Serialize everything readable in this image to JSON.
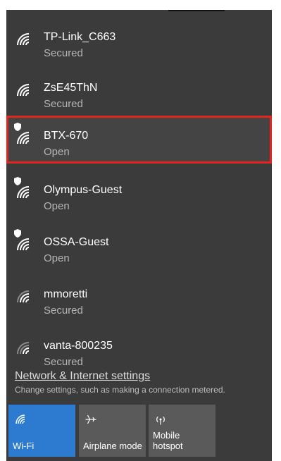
{
  "networks": [
    {
      "name": "TP-Link_C663",
      "status": "Secured",
      "shield": false
    },
    {
      "name": "ZsE45ThN",
      "status": "Secured",
      "shield": false
    },
    {
      "name": "BTX-670",
      "status": "Open",
      "shield": true,
      "selected": true
    },
    {
      "name": "Olympus-Guest",
      "status": "Open",
      "shield": true
    },
    {
      "name": "OSSA-Guest",
      "status": "Open",
      "shield": true
    },
    {
      "name": "mmoretti",
      "status": "Secured",
      "shield": false
    },
    {
      "name": "vanta-800235",
      "status": "Secured",
      "shield": false
    }
  ],
  "settings": {
    "link": "Network & Internet settings",
    "description": "Change settings, such as making a connection metered."
  },
  "tiles": {
    "wifi": {
      "label": "Wi-Fi",
      "icon": "wifi-icon",
      "active": true
    },
    "airplane": {
      "label": "Airplane mode",
      "icon": "airplane-icon"
    },
    "hotspot": {
      "label_line1": "Mobile",
      "label_line2": "hotspot",
      "icon": "hotspot-icon"
    }
  },
  "colors": {
    "panel_bg": "#3b3b3b",
    "selection_border": "#e0261e",
    "tile_active": "#2c7bd1",
    "tile_inactive": "#5a5a5a"
  }
}
